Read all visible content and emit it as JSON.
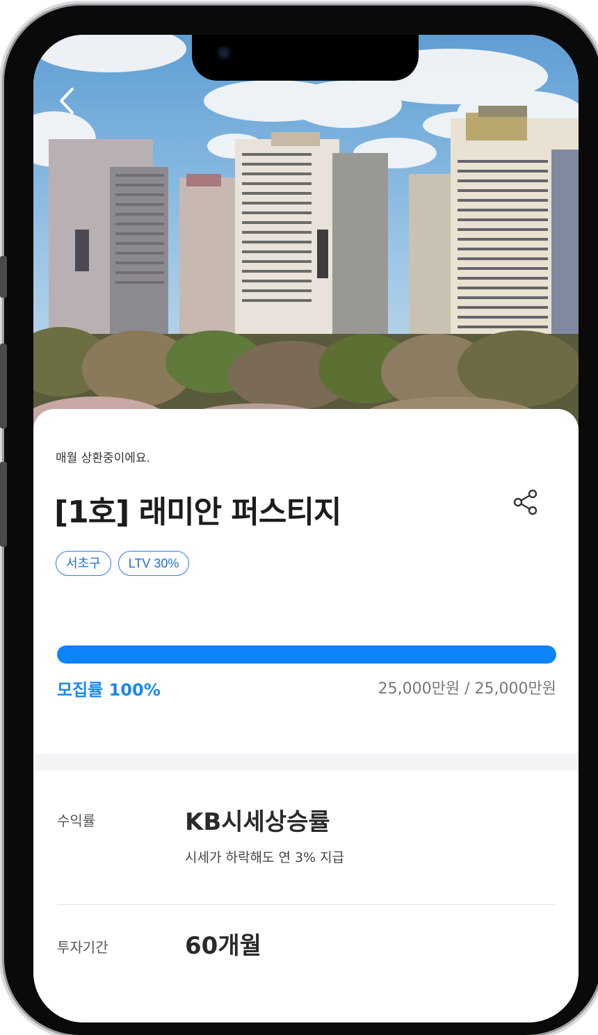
{
  "nav": {
    "back_icon": "chevron-left-icon"
  },
  "product": {
    "status": "매월 상환중이에요.",
    "title": "[1호] 래미안 퍼스티지",
    "share_icon": "share-icon",
    "tags": [
      "서초구",
      "LTV 30%"
    ]
  },
  "funding": {
    "progress_percent": 100,
    "rate_label": "모집률 100%",
    "amount": "25,000만원 / 25,000만원"
  },
  "details": [
    {
      "label": "수익률",
      "value": "KB시세상승률",
      "sub": "시세가 하락해도 연 3% 지급"
    },
    {
      "label": "투자기간",
      "value": "60개월"
    }
  ],
  "colors": {
    "accent": "#0d84f7",
    "tag": "#2b7be5"
  }
}
